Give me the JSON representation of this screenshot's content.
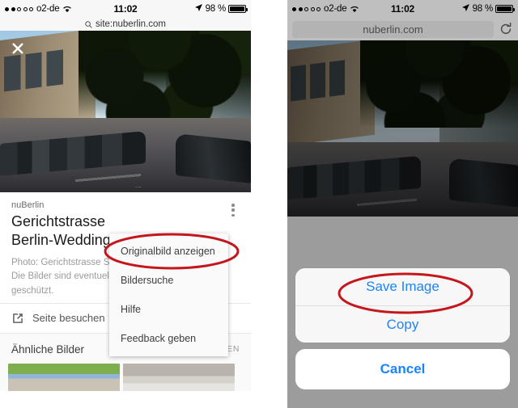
{
  "left_phone": {
    "status_bar": {
      "signal_dots_filled": 2,
      "signal_dots_total": 5,
      "carrier": "o2-de",
      "wifi_icon": "wifi-icon",
      "time": "11:02",
      "location_icon": "location-arrow-icon",
      "battery_percent": "98 %",
      "battery_level": 100
    },
    "search_bar": {
      "icon": "search-icon",
      "query": "site:nuberlin.com"
    },
    "hero": {
      "close_icon": "close-icon",
      "alt": "Street view photo of Gerichtstrasse in Berlin-Wedding"
    },
    "result_card": {
      "site_name": "nuBerlin",
      "title_line1": "Gerichtstrasse",
      "title_line2": "Berlin-Wedding",
      "description_line1": "Photo: Gerichtstrasse S",
      "description_line2": "Die Bilder sind eventuel",
      "description_line3": "geschützt.",
      "overflow_icon": "kebab-menu-icon"
    },
    "visit_row": {
      "icon": "external-link-icon",
      "label": "Seite besuchen"
    },
    "similar_section": {
      "label": "Ähnliche Bilder",
      "show_all": "ALLE ANZEIGEN"
    },
    "context_menu": {
      "items": [
        "Originalbild anzeigen",
        "Bildersuche",
        "Hilfe",
        "Feedback geben"
      ],
      "highlighted_item": "Originalbild anzeigen"
    }
  },
  "right_phone": {
    "status_bar": {
      "signal_dots_filled": 2,
      "signal_dots_total": 5,
      "carrier": "o2-de",
      "wifi_icon": "wifi-icon",
      "time": "11:02",
      "location_icon": "location-arrow-icon",
      "battery_percent": "98 %",
      "battery_level": 100
    },
    "url_bar": {
      "url": "nuberlin.com",
      "reload_icon": "reload-icon"
    },
    "hero": {
      "alt": "Street view photo of Gerichtstrasse in Berlin-Wedding, dimmed"
    },
    "action_sheet": {
      "buttons": [
        "Save Image",
        "Copy"
      ],
      "cancel_label": "Cancel",
      "highlighted_item": "Save Image"
    }
  },
  "annotations": {
    "color": "#c4161c",
    "stroke_width": 3,
    "shapes": [
      "ellipse-originalbild-anzeigen",
      "ellipse-save-image"
    ]
  },
  "colors": {
    "accent_blue": "#1b84fb",
    "annotation_red": "#c4161c",
    "status_bar_bg": "#f7f7f7",
    "dim_overlay": "#9c9c9c"
  }
}
